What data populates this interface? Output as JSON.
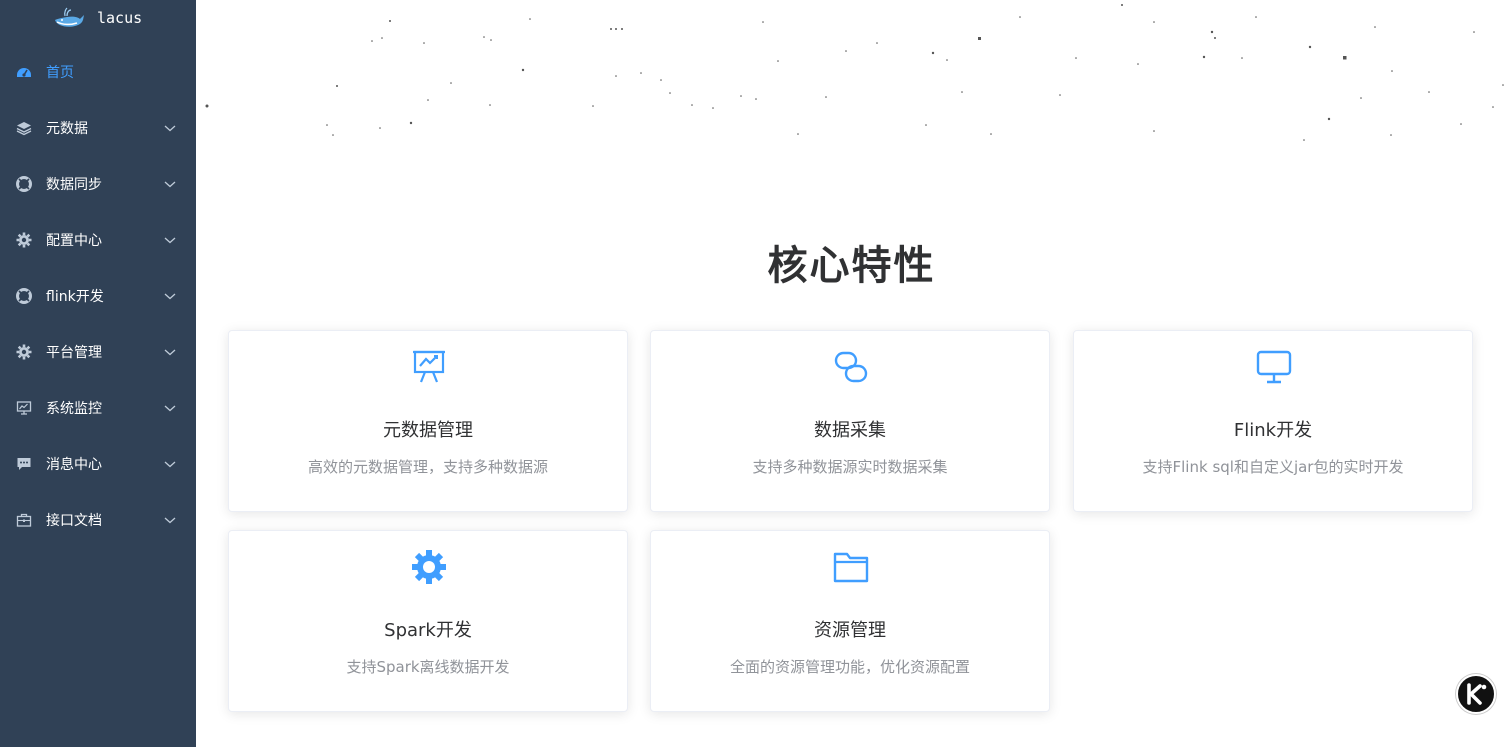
{
  "app": {
    "logo_text": "lacus",
    "accent_color": "#409eff",
    "sidebar_color": "#304156"
  },
  "sidebar": {
    "items": [
      {
        "label": "首页",
        "icon": "dashboard-icon",
        "active": true
      },
      {
        "label": "元数据",
        "icon": "layers-icon"
      },
      {
        "label": "数据同步",
        "icon": "lifebuoy-icon"
      },
      {
        "label": "配置中心",
        "icon": "gear-icon"
      },
      {
        "label": "flink开发",
        "icon": "lifebuoy-icon"
      },
      {
        "label": "平台管理",
        "icon": "gear-icon"
      },
      {
        "label": "系统监控",
        "icon": "monitor-chart-icon"
      },
      {
        "label": "消息中心",
        "icon": "chat-bubble-icon"
      },
      {
        "label": "接口文档",
        "icon": "briefcase-icon"
      }
    ]
  },
  "main": {
    "section_title": "核心特性",
    "features": [
      {
        "title": "元数据管理",
        "desc": "高效的元数据管理，支持多种数据源",
        "icon": "presentation-chart-icon"
      },
      {
        "title": "数据采集",
        "desc": "支持多种数据源实时数据采集",
        "icon": "link-icon"
      },
      {
        "title": "Flink开发",
        "desc": "支持Flink sql和自定义jar包的实时开发",
        "icon": "monitor-icon"
      },
      {
        "title": "Spark开发",
        "desc": "支持Spark离线数据开发",
        "icon": "gear-icon"
      },
      {
        "title": "资源管理",
        "desc": "全面的资源管理功能，优化资源配置",
        "icon": "folder-icon"
      }
    ]
  },
  "floating_button": {
    "icon": "k-logo-icon"
  }
}
